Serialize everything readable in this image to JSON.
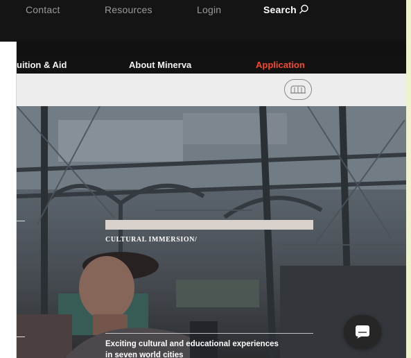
{
  "topbar": {
    "contact_label": "Contact",
    "resources_label": "Resources",
    "login_label": "Login",
    "search_label": "Search"
  },
  "mainnav": {
    "tuition_label": "uition & Aid",
    "about_label": "About Minerva",
    "application_label": "Application"
  },
  "hero": {
    "kicker": "CULTURAL IMMERSION/",
    "caption": "Exciting cultural and educational experiences in seven world cities"
  },
  "colors": {
    "nav_bg": "#121212",
    "accent": "#f24a2a",
    "subbar_bg": "#ededed",
    "page_bg": "#f5f8dc"
  },
  "icons": {
    "search": "search-icon",
    "logo": "minerva-logo-icon",
    "chat": "chat-icon"
  }
}
